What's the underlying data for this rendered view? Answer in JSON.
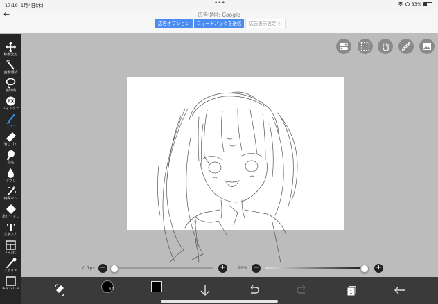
{
  "status_bar": {
    "time": "17:10",
    "date": "1月4日(木)",
    "dots": "•••",
    "battery": "33%",
    "battery_level": 0.33
  },
  "ad_bar": {
    "back": "←",
    "title_prefix": "広告提供:",
    "title_brand": "Google",
    "buttons": [
      "広告オプション",
      "フィードバックを送信",
      "広告表示設定 ⓘ"
    ]
  },
  "tools": [
    {
      "name": "move",
      "label": "移動変形",
      "icon": "move-icon"
    },
    {
      "name": "auto-select",
      "label": "自動選択",
      "icon": "magic-wand-icon"
    },
    {
      "name": "lasso",
      "label": "投げ縄",
      "icon": "lasso-icon"
    },
    {
      "name": "filter",
      "label": "フィルター",
      "icon": "fx-icon"
    },
    {
      "name": "brush",
      "label": "ブラシ",
      "icon": "brush-icon",
      "active": true
    },
    {
      "name": "eraser",
      "label": "消しゴム",
      "icon": "eraser-icon"
    },
    {
      "name": "smudge",
      "label": "指先",
      "icon": "finger-icon"
    },
    {
      "name": "blur",
      "label": "ぼかし",
      "icon": "drop-icon"
    },
    {
      "name": "special-pen",
      "label": "特殊ペン",
      "icon": "sparkle-pen-icon"
    },
    {
      "name": "fill",
      "label": "塗りつぶし",
      "icon": "bucket-icon"
    },
    {
      "name": "text",
      "label": "文字入れ",
      "icon": "text-icon"
    },
    {
      "name": "frame",
      "label": "コマ割り",
      "icon": "frame-icon"
    },
    {
      "name": "eyedropper",
      "label": "スポイト",
      "icon": "eyedropper-icon"
    },
    {
      "name": "canvas",
      "label": "キャンバス",
      "icon": "canvas-icon"
    }
  ],
  "sliders": {
    "size_label": "0.7px",
    "size_level": 0.0,
    "opacity_label": "99%",
    "opacity_level": 0.99,
    "minus": "−",
    "plus": "+"
  },
  "bottom_bar": {
    "brush_size": "0.7",
    "color": "#000000"
  },
  "colors": {
    "toolbar": "#262626",
    "accent": "#3d8eea",
    "canvas_bg": "#bcbcbc",
    "bottom": "#3a3a3a"
  }
}
